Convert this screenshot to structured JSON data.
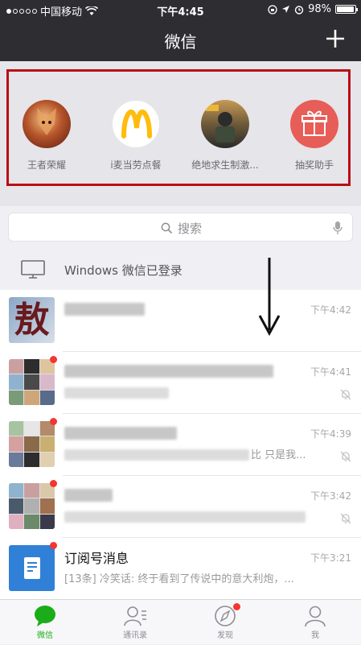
{
  "status_bar": {
    "carrier": "中国移动",
    "time": "下午4:45",
    "battery": "98%",
    "battery_level": 0.98
  },
  "navbar": {
    "title": "微信",
    "add_icon": "plus-icon"
  },
  "mini_programs": [
    {
      "label": "王者荣耀",
      "icon": "game-hero-avatar"
    },
    {
      "label": "i麦当劳点餐",
      "icon": "mcdonalds-logo"
    },
    {
      "label": "绝地求生制激...",
      "icon": "pubg-avatar"
    },
    {
      "label": "抽奖助手",
      "icon": "gift-icon"
    }
  ],
  "search": {
    "placeholder": "搜索"
  },
  "windows_login": {
    "label": "Windows 微信已登录"
  },
  "chats": [
    {
      "name": "",
      "avatar_char": "敖",
      "message": "",
      "time": "下午4:42",
      "muted": false,
      "unread": false
    },
    {
      "name": "",
      "message": "",
      "time": "下午4:41",
      "muted": true,
      "unread": true
    },
    {
      "name": "",
      "message": "比 只是我...",
      "time": "下午4:39",
      "muted": true,
      "unread": true
    },
    {
      "name": "",
      "message": "",
      "time": "下午3:42",
      "muted": true,
      "unread": true
    },
    {
      "name": "订阅号消息",
      "message": "[13条] 冷笑话: 终于看到了传说中的意大利炮，...",
      "time": "下午3:21",
      "muted": false,
      "unread": true
    }
  ],
  "tabs": [
    {
      "label": "微信",
      "icon": "chat-bubble-icon",
      "active": true
    },
    {
      "label": "通讯录",
      "icon": "contacts-icon",
      "active": false
    },
    {
      "label": "发现",
      "icon": "compass-icon",
      "active": false
    },
    {
      "label": "我",
      "icon": "person-icon",
      "active": false
    }
  ],
  "colors": {
    "accent": "#1aad19",
    "navbar": "#2e2e32",
    "highlight_border": "#b80f16",
    "badge": "#f43530"
  }
}
